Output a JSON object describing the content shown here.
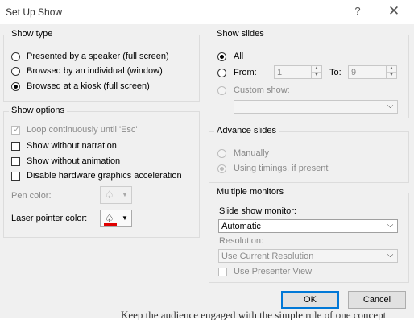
{
  "window": {
    "title": "Set Up Show",
    "help_label": "?",
    "close_label": "✕"
  },
  "show_type": {
    "legend": "Show type",
    "options": [
      {
        "label": "Presented by a speaker (full screen)",
        "checked": false
      },
      {
        "label": "Browsed by an individual (window)",
        "checked": false
      },
      {
        "label": "Browsed at a kiosk (full screen)",
        "checked": true
      }
    ]
  },
  "show_options": {
    "legend": "Show options",
    "loop_label": "Loop continuously until 'Esc'",
    "no_narration_label": "Show without narration",
    "no_animation_label": "Show without animation",
    "disable_hw_label": "Disable hardware graphics acceleration",
    "pen_color_label": "Pen color:",
    "laser_color_label": "Laser pointer color:",
    "laser_color": "#e00000"
  },
  "show_slides": {
    "legend": "Show slides",
    "all_label": "All",
    "from_label": "From:",
    "from_value": "1",
    "to_label": "To:",
    "to_value": "9",
    "custom_label": "Custom show:"
  },
  "advance_slides": {
    "legend": "Advance slides",
    "manual_label": "Manually",
    "timings_label": "Using timings, if present"
  },
  "monitors": {
    "legend": "Multiple monitors",
    "slide_show_monitor_label": "Slide show monitor:",
    "monitor_value": "Automatic",
    "resolution_label": "Resolution:",
    "resolution_value": "Use Current Resolution",
    "presenter_view_label": "Use Presenter View"
  },
  "buttons": {
    "ok": "OK",
    "cancel": "Cancel"
  },
  "background_text": "Keep the audience engaged with the simple rule of one concept"
}
